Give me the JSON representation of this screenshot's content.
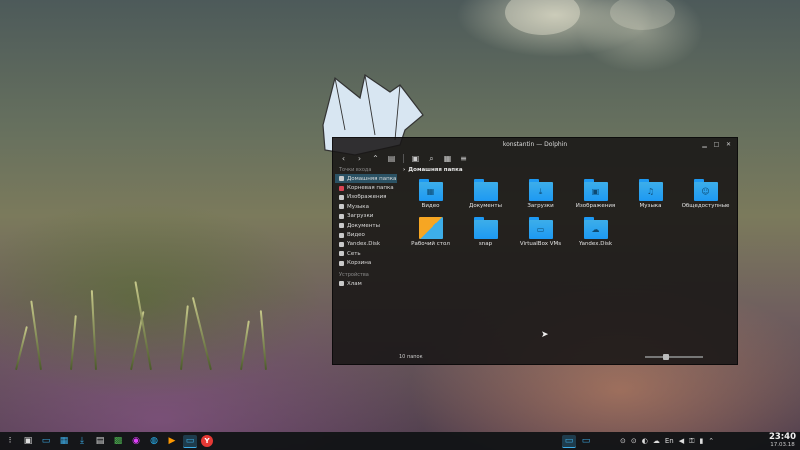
{
  "window": {
    "title": "konstantin — Dolphin",
    "controls": {
      "minimize": "▁",
      "maximize": "□",
      "close": "✕"
    }
  },
  "toolbar": {
    "back": "‹",
    "forward": "›",
    "up": "⌃",
    "view": "▤",
    "preview": "▣",
    "search": "⌕",
    "image": "▦",
    "menu": "≡"
  },
  "sidebar": {
    "section_places": "Точки входа",
    "places": [
      {
        "label": "Домашняя папка",
        "icon": "home-icon"
      },
      {
        "label": "Корневая папка",
        "icon": "root-folder-icon"
      },
      {
        "label": "Изображения",
        "icon": "image-icon"
      },
      {
        "label": "Музыка",
        "icon": "music-icon"
      },
      {
        "label": "Загрузки",
        "icon": "download-icon"
      },
      {
        "label": "Документы",
        "icon": "document-icon"
      },
      {
        "label": "Видео",
        "icon": "video-icon"
      },
      {
        "label": "Yandex.Disk",
        "icon": "cloud-icon"
      },
      {
        "label": "Сеть",
        "icon": "network-icon"
      },
      {
        "label": "Корзина",
        "icon": "trash-icon"
      }
    ],
    "section_devices": "Устройства",
    "devices": [
      {
        "label": "Хлам",
        "icon": "drive-icon"
      }
    ]
  },
  "breadcrumb": {
    "separator": "›",
    "current": "Домашняя папка"
  },
  "files": [
    {
      "label": "Видео",
      "glyph": "▦"
    },
    {
      "label": "Документы",
      "glyph": ""
    },
    {
      "label": "Загрузки",
      "glyph": "⤓"
    },
    {
      "label": "Изображения",
      "glyph": "▣"
    },
    {
      "label": "Музыка",
      "glyph": "♫"
    },
    {
      "label": "Общедоступные",
      "glyph": "☺"
    },
    {
      "label": "Рабочий стол",
      "glyph": ""
    },
    {
      "label": "snap",
      "glyph": ""
    },
    {
      "label": "VirtualBox VMs",
      "glyph": "▭"
    },
    {
      "label": "Yandex.Disk",
      "glyph": "☁"
    }
  ],
  "status": {
    "count": "10 папок",
    "zoom_level": 0.35
  },
  "taskbar": {
    "launcher": "⁝",
    "tasks": [
      "▣",
      "▭",
      "▦",
      "⤓",
      "▤",
      "▩",
      "◉",
      "◍",
      "▶",
      "▭",
      "Y"
    ],
    "running": [
      "▭",
      "▭"
    ],
    "tray": [
      "⊙",
      "⊙",
      "◐",
      "☁",
      "En",
      "◀",
      "⚿",
      "▮",
      "⌃"
    ],
    "time": "23:40",
    "date": "17.03.18"
  },
  "colors": {
    "accent": "#3daee9",
    "folder": "#1d99f3"
  }
}
